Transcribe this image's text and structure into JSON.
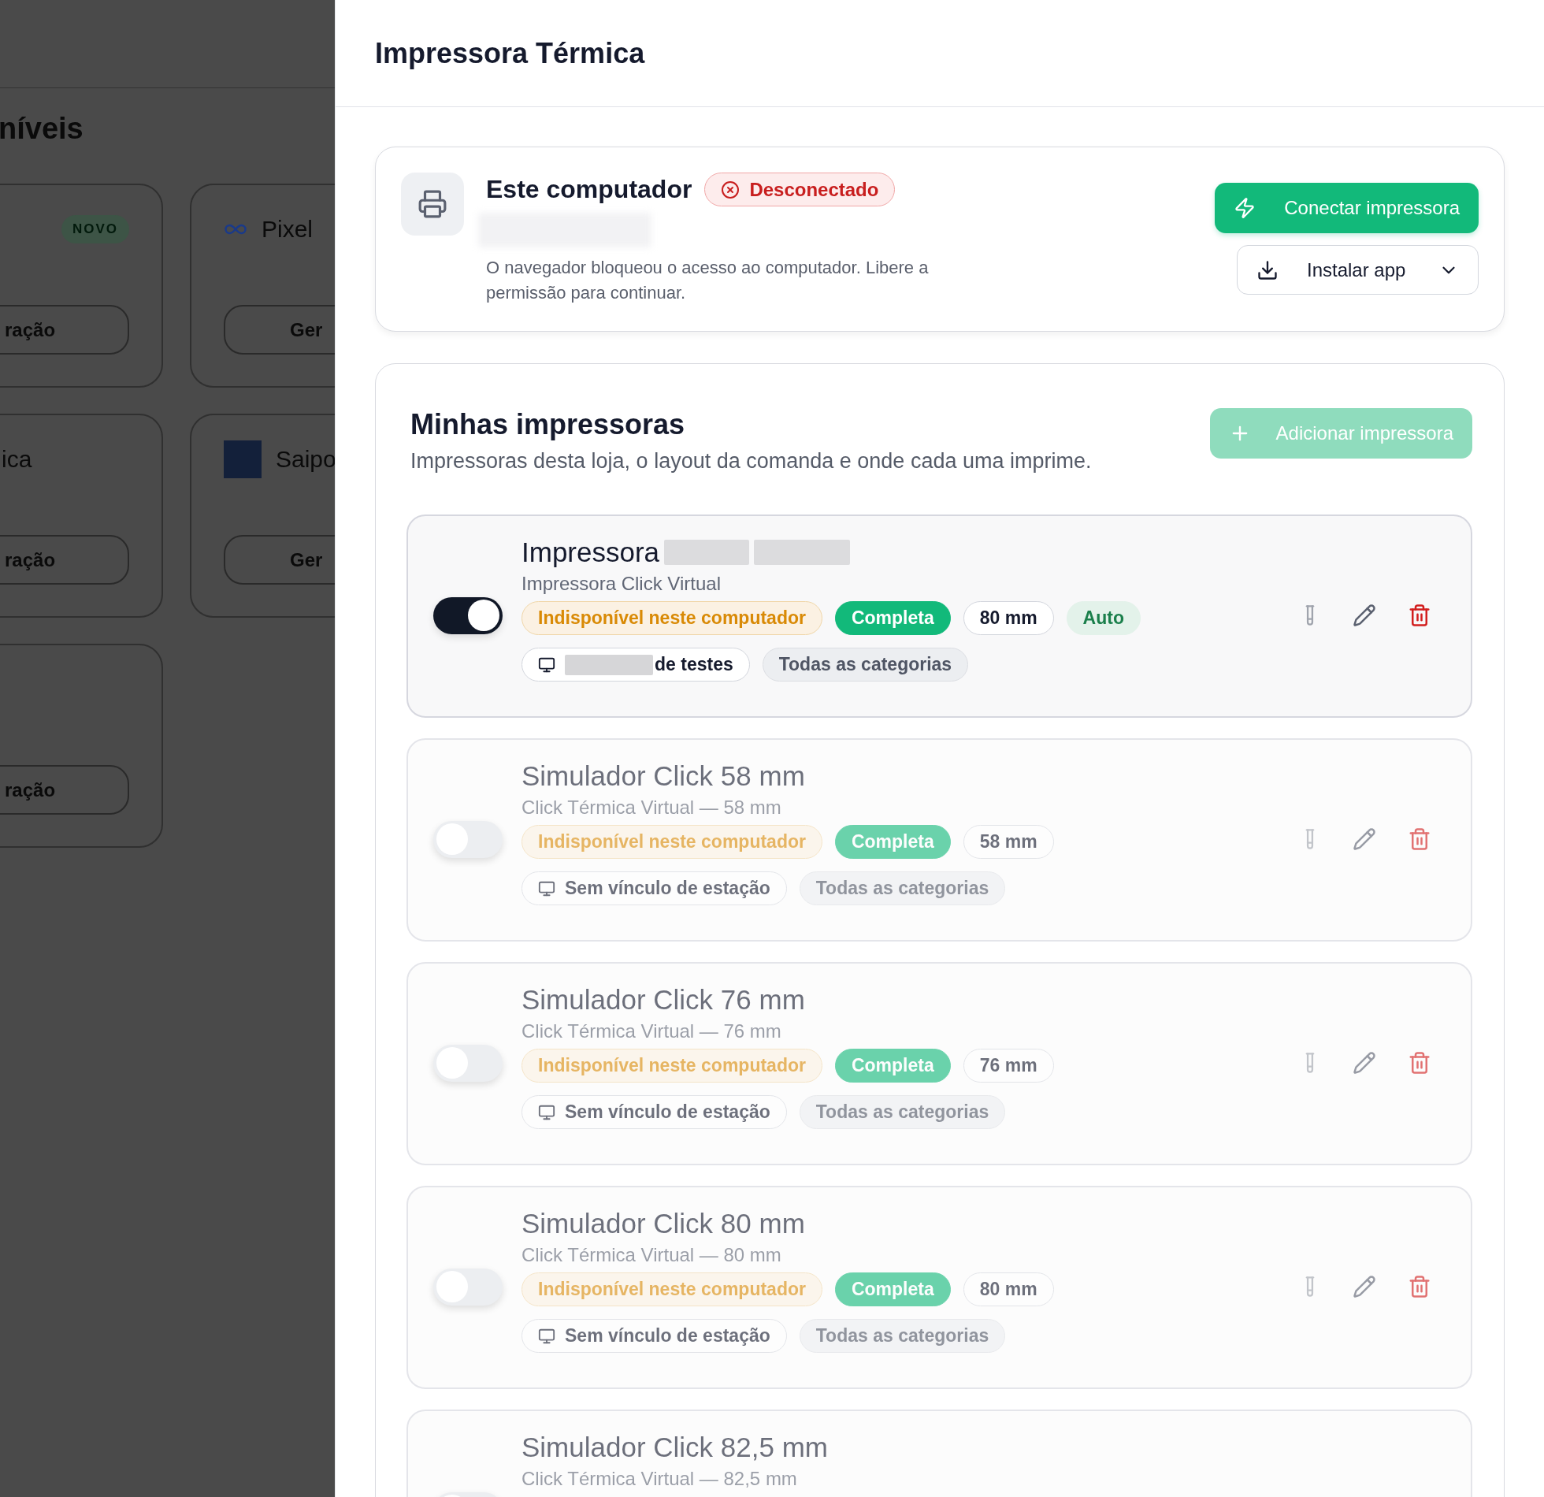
{
  "background_page": {
    "heading": "níveis",
    "cards": [
      {
        "badge": "NOVO",
        "button": "ração"
      },
      {
        "title": "Pixel",
        "button": "Ger"
      },
      {
        "title": "ica",
        "button": "ração"
      },
      {
        "title": "Saipo",
        "button": "Ger"
      },
      {
        "button": "ração"
      }
    ]
  },
  "drawer": {
    "title": "Impressora Térmica",
    "computer": {
      "title": "Este computador",
      "status": "Desconectado",
      "connected": false,
      "message": "O navegador bloqueou o acesso ao computador. Libere a permissão para continuar.",
      "connect_button": "Conectar impressora",
      "install_button": "Instalar app"
    },
    "printers_section": {
      "title": "Minhas impressoras",
      "subtitle": "Impressoras desta loja, o layout da comanda e onde cada uma imprime.",
      "add_button": "Adicionar impressora",
      "add_disabled": true,
      "printers": [
        {
          "name": "Impressora",
          "name_redacted": true,
          "subtitle": "Impressora Click Virtual",
          "on": true,
          "chips": [
            {
              "kind": "status",
              "label": "Indisponível neste computador"
            },
            {
              "kind": "mode",
              "label": "Completa"
            },
            {
              "kind": "size",
              "label": "80 mm"
            },
            {
              "kind": "auto",
              "label": "Auto"
            }
          ],
          "tags": [
            {
              "kind": "station",
              "label": "de testes",
              "redacted": true
            },
            {
              "kind": "category",
              "label": "Todas as categorias"
            }
          ]
        },
        {
          "name": "Simulador Click 58 mm",
          "name_redacted": false,
          "subtitle": "Click Térmica Virtual — 58 mm",
          "on": false,
          "chips": [
            {
              "kind": "status",
              "label": "Indisponível neste computador"
            },
            {
              "kind": "mode",
              "label": "Completa"
            },
            {
              "kind": "size",
              "label": "58 mm"
            }
          ],
          "tags": [
            {
              "kind": "station",
              "label": "Sem vínculo de estação",
              "redacted": false
            },
            {
              "kind": "category",
              "label": "Todas as categorias"
            }
          ]
        },
        {
          "name": "Simulador Click 76 mm",
          "name_redacted": false,
          "subtitle": "Click Térmica Virtual — 76 mm",
          "on": false,
          "chips": [
            {
              "kind": "status",
              "label": "Indisponível neste computador"
            },
            {
              "kind": "mode",
              "label": "Completa"
            },
            {
              "kind": "size",
              "label": "76 mm"
            }
          ],
          "tags": [
            {
              "kind": "station",
              "label": "Sem vínculo de estação",
              "redacted": false
            },
            {
              "kind": "category",
              "label": "Todas as categorias"
            }
          ]
        },
        {
          "name": "Simulador Click 80 mm",
          "name_redacted": false,
          "subtitle": "Click Térmica Virtual — 80 mm",
          "on": false,
          "chips": [
            {
              "kind": "status",
              "label": "Indisponível neste computador"
            },
            {
              "kind": "mode",
              "label": "Completa"
            },
            {
              "kind": "size",
              "label": "80 mm"
            }
          ],
          "tags": [
            {
              "kind": "station",
              "label": "Sem vínculo de estação",
              "redacted": false
            },
            {
              "kind": "category",
              "label": "Todas as categorias"
            }
          ]
        },
        {
          "name": "Simulador Click 82,5 mm",
          "name_redacted": false,
          "subtitle": "Click Térmica Virtual — 82,5 mm",
          "on": false
        }
      ]
    }
  }
}
